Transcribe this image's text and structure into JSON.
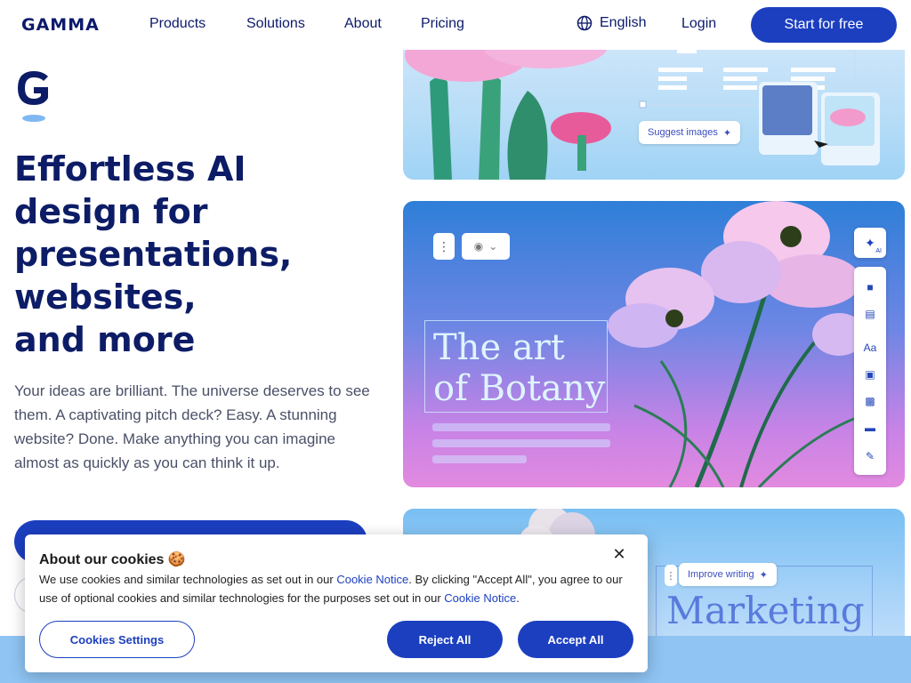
{
  "nav": {
    "logo": "GAMMA",
    "links": [
      "Products",
      "Solutions",
      "About",
      "Pricing"
    ],
    "language": "English",
    "login": "Login",
    "cta": "Start for free"
  },
  "hero": {
    "title_lines": [
      "Effortless AI",
      "design for",
      "presentations,",
      "websites,",
      "and more"
    ],
    "subtitle": "Your ideas are brilliant. The universe deserves to see them. A captivating pitch deck? Easy. A stunning website? Done. Make anything you can imagine almost as quickly as you can think it up."
  },
  "cards": {
    "suggest_label": "Suggest images",
    "botany_lines": [
      "The art",
      "of Botany"
    ],
    "ai_badge": "AI",
    "improve_label": "Improve writing",
    "marketing_word": "Marketing"
  },
  "cookie": {
    "title": "About our cookies 🍪",
    "text_part1": "We use cookies and similar technologies as set out in our ",
    "link1": "Cookie Notice",
    "text_part2": ". By clicking \"Accept All\", you agree to our use of optional cookies and similar technologies for the purposes set out in our ",
    "link2": "Cookie Notice",
    "text_part3": ".",
    "settings_label": "Cookies Settings",
    "reject_label": "Reject All",
    "accept_label": "Accept All",
    "close_symbol": "✕"
  },
  "colors": {
    "brand": "#1c3fc0",
    "heading": "#0d1c66"
  }
}
